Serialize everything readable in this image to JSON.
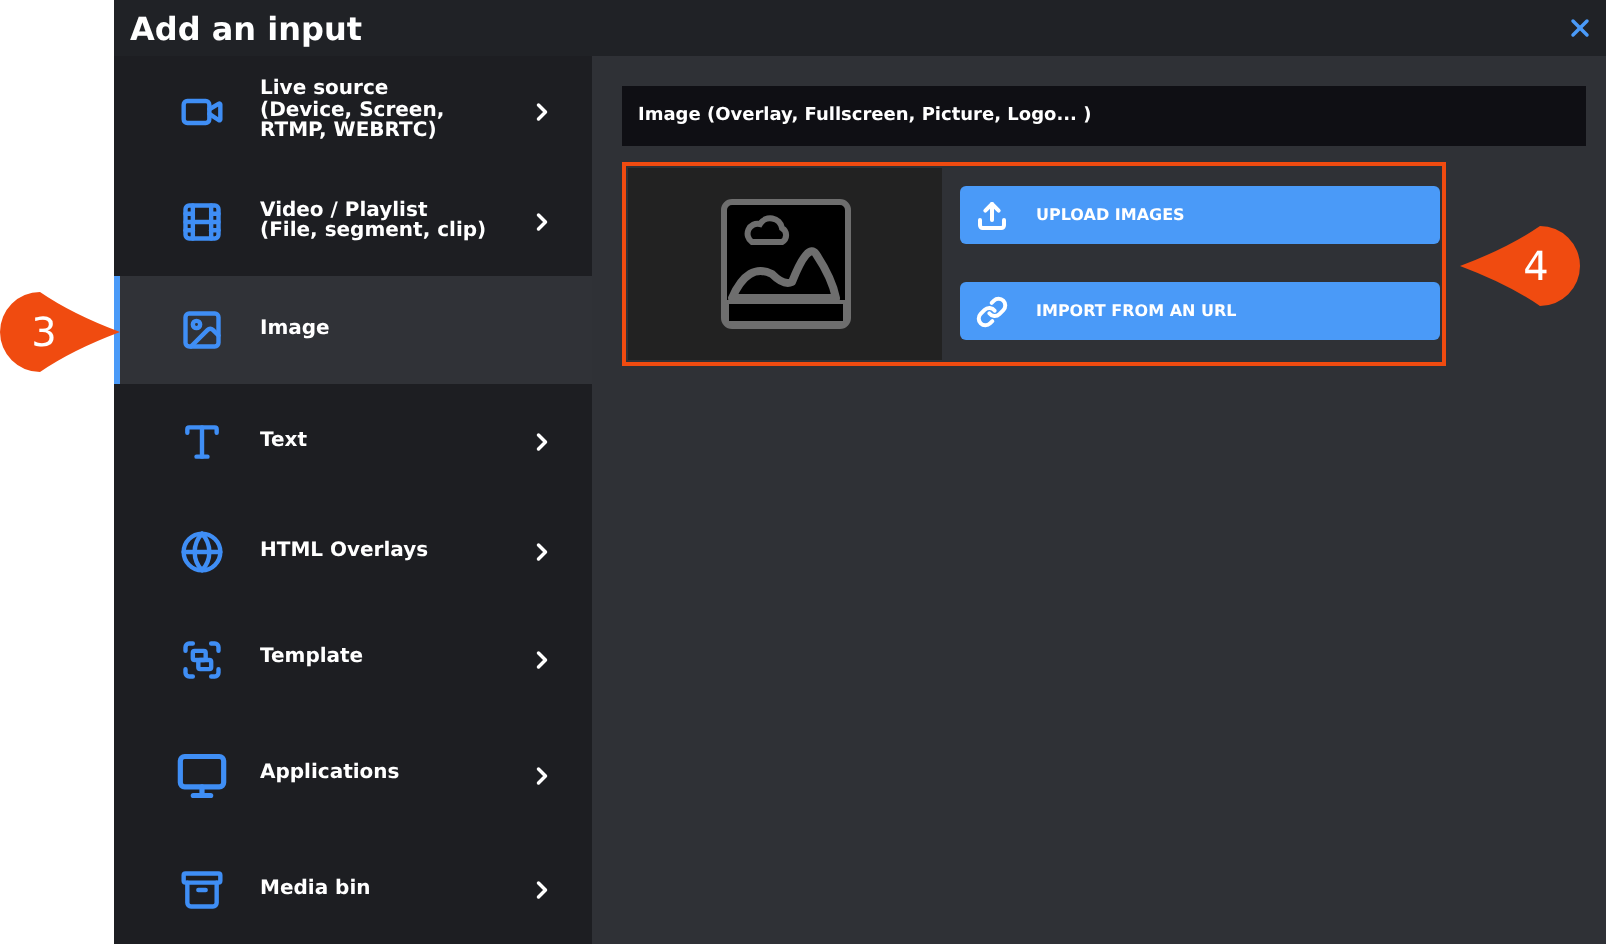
{
  "window": {
    "title": "Add an input"
  },
  "sidebar": {
    "items": [
      {
        "kind": "camera",
        "label": "Live source\n(Device, Screen,\nRTMP, WEBRTC)",
        "selected": false,
        "expandable": true
      },
      {
        "kind": "film",
        "label": "Video / Playlist\n(File, segment, clip)",
        "selected": false,
        "expandable": true
      },
      {
        "kind": "image",
        "label": "Image",
        "selected": true,
        "expandable": false
      },
      {
        "kind": "text",
        "label": "Text",
        "selected": false,
        "expandable": true
      },
      {
        "kind": "globe",
        "label": "HTML Overlays",
        "selected": false,
        "expandable": true
      },
      {
        "kind": "template",
        "label": "Template",
        "selected": false,
        "expandable": true
      },
      {
        "kind": "monitor",
        "label": "Applications",
        "selected": false,
        "expandable": true
      },
      {
        "kind": "archive",
        "label": "Media bin",
        "selected": false,
        "expandable": true
      }
    ]
  },
  "panel": {
    "heading": "Image (Overlay, Fullscreen, Picture, Logo... )",
    "buttons": [
      {
        "kind": "upload",
        "label": "UPLOAD IMAGES"
      },
      {
        "kind": "link",
        "label": "IMPORT FROM AN URL"
      }
    ]
  },
  "callouts": [
    {
      "label": "3"
    },
    {
      "label": "4"
    }
  ]
}
